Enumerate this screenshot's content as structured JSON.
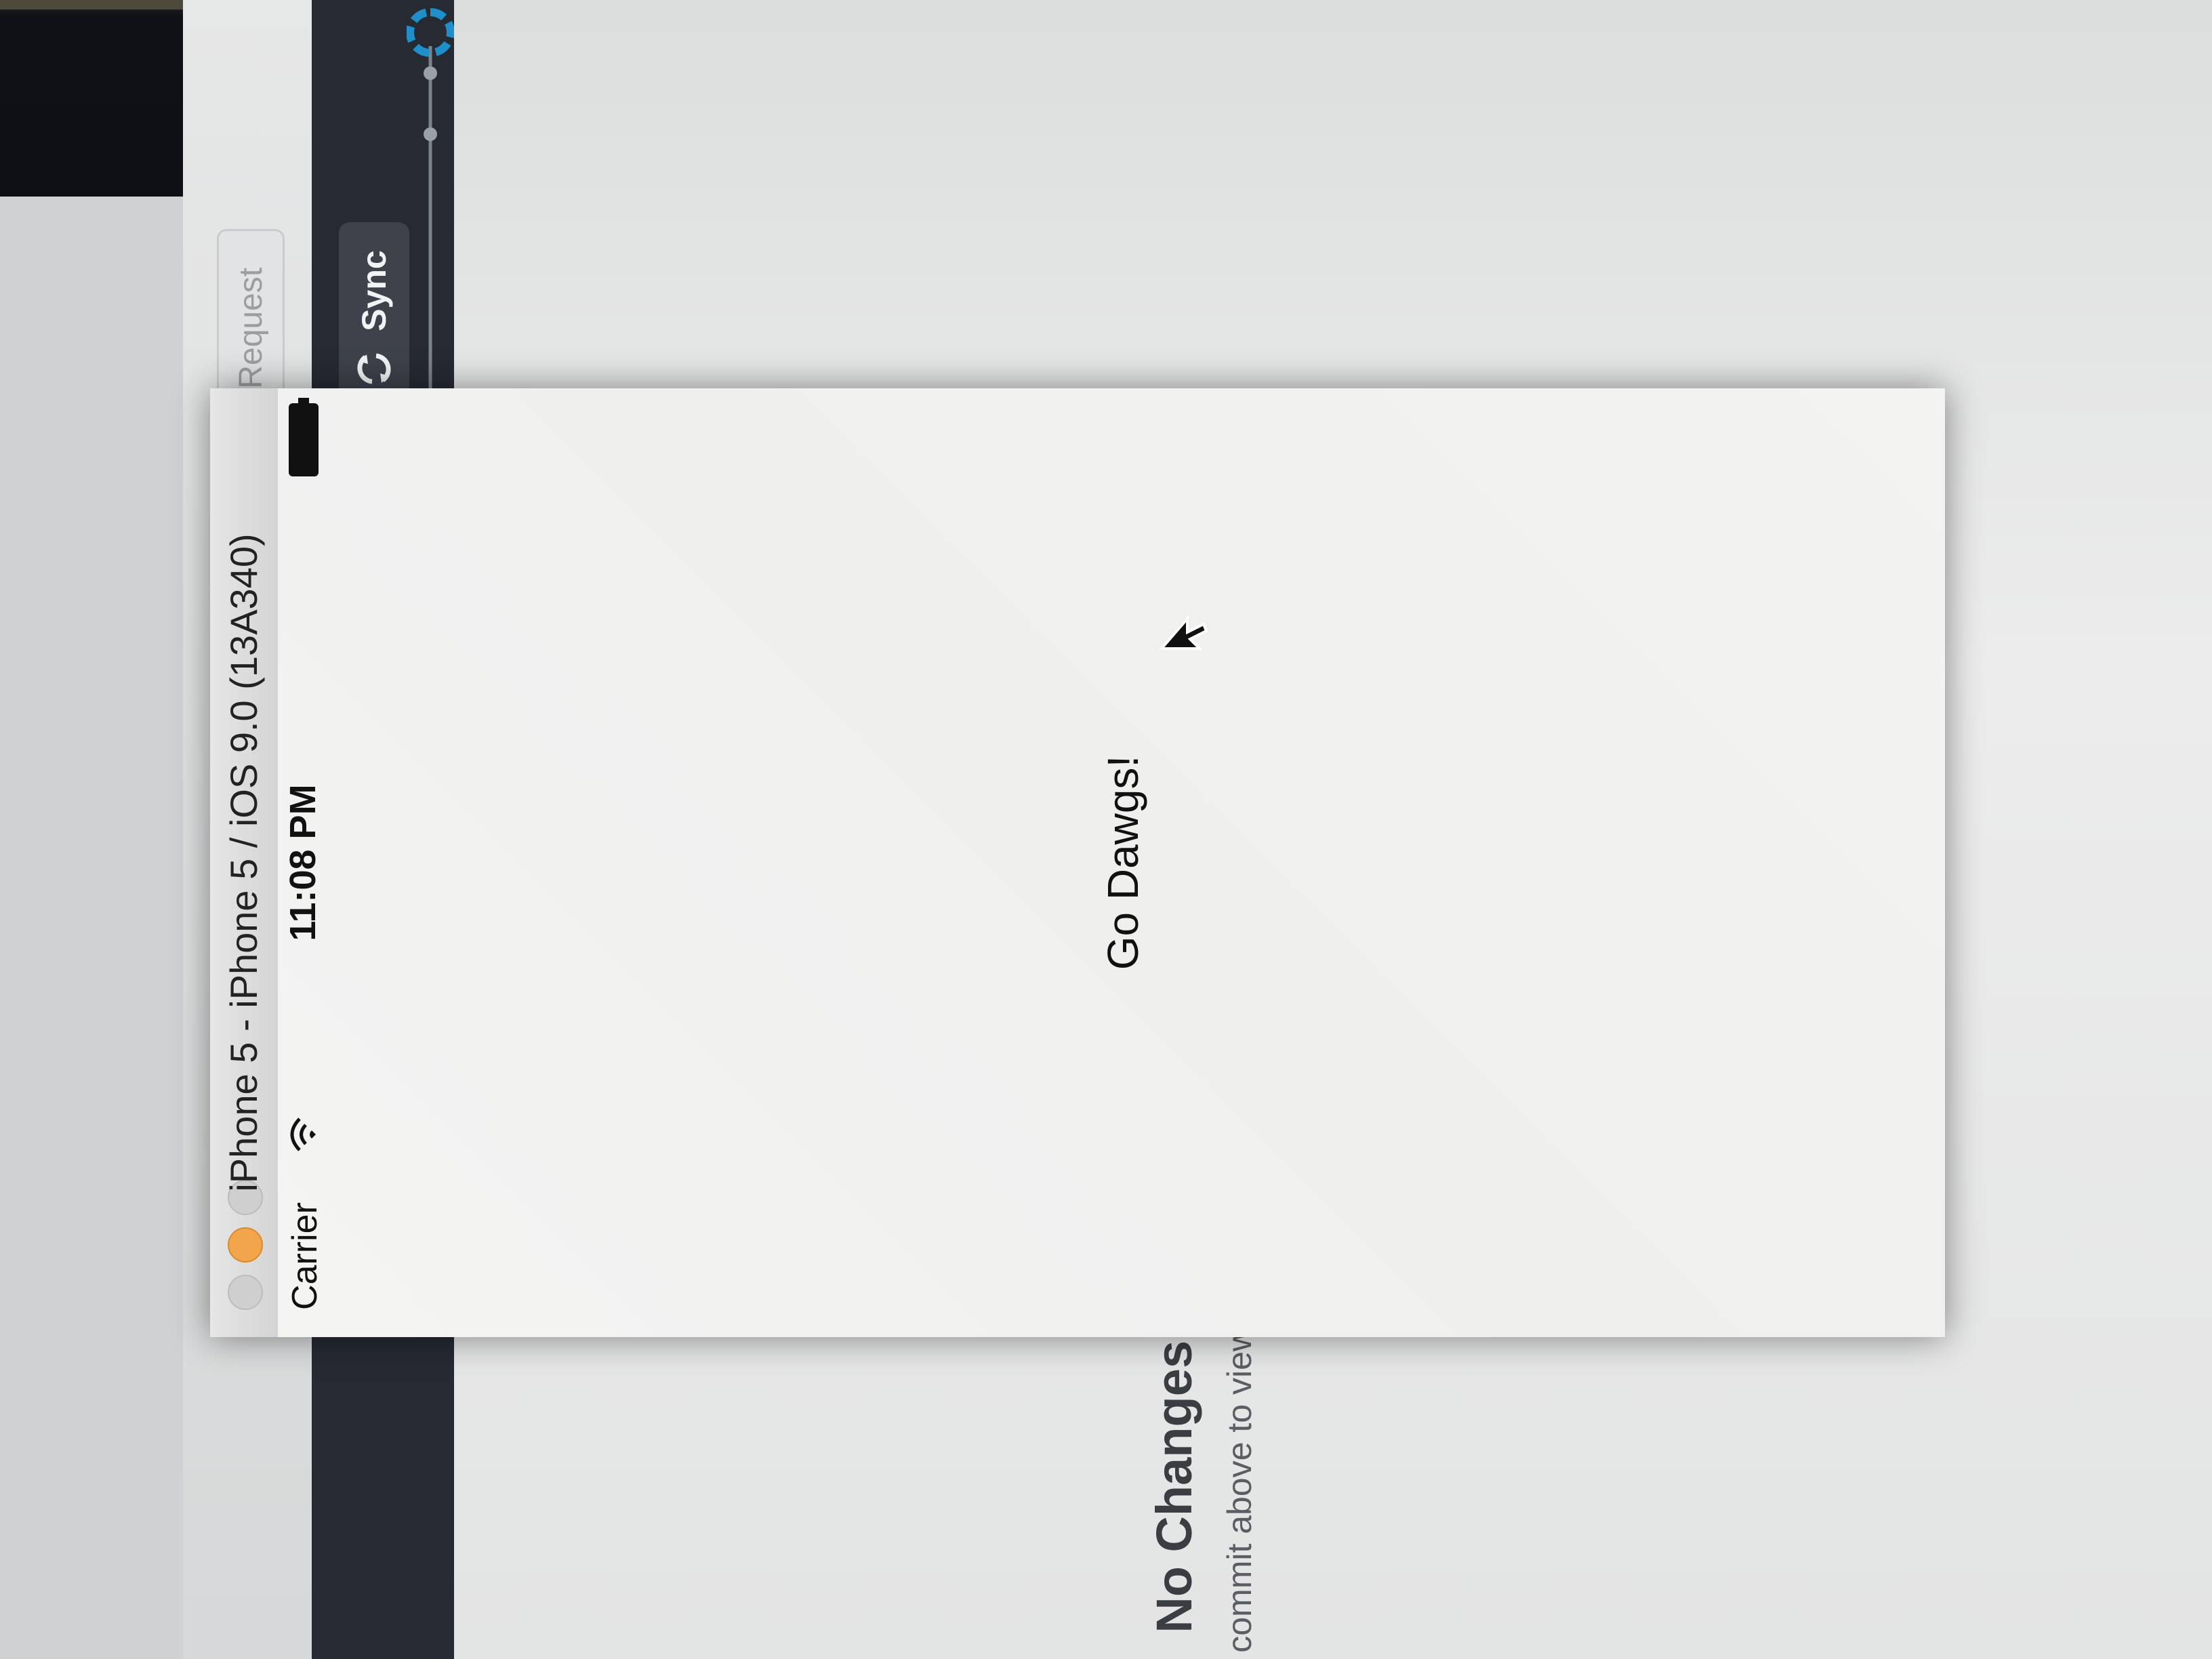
{
  "toolbar": {
    "pull_request_label": "Pull Request",
    "sync_label": "Sync"
  },
  "simulator": {
    "window_title": "iPhone 5 - iPhone 5 / iOS 9.0 (13A340)",
    "status_bar": {
      "carrier": "Carrier",
      "time": "11:08 PM"
    },
    "app_label": "Go Dawgs!"
  },
  "changes_panel": {
    "title": "No Changes",
    "subtitle": "commit above to view"
  },
  "colors": {
    "dark_toolbar": "#262a33",
    "sync_button": "#3d424b",
    "timeline_accent": "#1e8fc9",
    "minimize_button": "#f2a54a"
  },
  "icons": [
    "pull-request-icon",
    "sync-icon",
    "wifi-icon",
    "battery-icon",
    "cursor-icon"
  ]
}
